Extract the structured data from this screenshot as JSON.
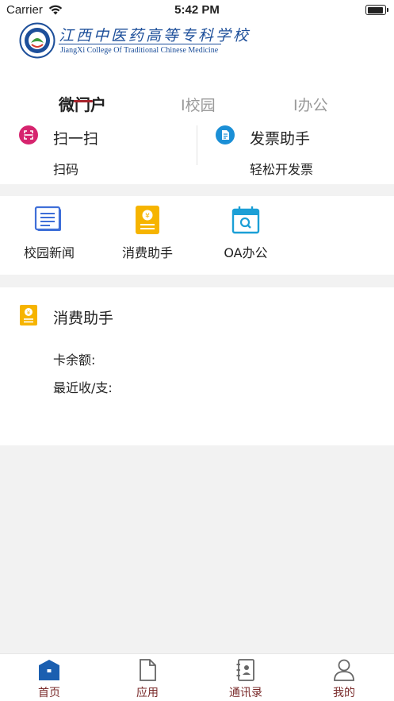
{
  "status_bar": {
    "carrier": "Carrier",
    "time": "5:42 PM",
    "battery_level": 0.95
  },
  "header": {
    "logo": {
      "name_cn": "江西中医药高等专科学校",
      "name_en": "JiangXi College Of Traditional Chinese Medicine"
    },
    "tabs": [
      {
        "label": "微门户",
        "active": true
      },
      {
        "label": "I校园",
        "active": false
      },
      {
        "label": "I办公",
        "active": false
      }
    ]
  },
  "quick_actions": [
    {
      "title": "扫一扫",
      "subtitle": "扫码",
      "icon": "scan-icon",
      "color": "#d6246e"
    },
    {
      "title": "发票助手",
      "subtitle": "轻松开发票",
      "icon": "invoice-icon",
      "color": "#1b8fd6"
    }
  ],
  "apps": [
    {
      "label": "校园新闻",
      "icon": "news-icon"
    },
    {
      "label": "消费助手",
      "icon": "wallet-icon"
    },
    {
      "label": "OA办公",
      "icon": "calendar-search-icon"
    }
  ],
  "card": {
    "title": "消费助手",
    "balance_label": "卡余额:",
    "recent_label": "最近收/支:"
  },
  "tabbar": [
    {
      "label": "首页",
      "icon": "home-icon",
      "active": true
    },
    {
      "label": "应用",
      "icon": "document-icon",
      "active": false
    },
    {
      "label": "通讯录",
      "icon": "contacts-icon",
      "active": false
    },
    {
      "label": "我的",
      "icon": "profile-icon",
      "active": false
    }
  ],
  "colors": {
    "accent": "#a8222b",
    "blue": "#1b5fb0",
    "yellow": "#f6b400",
    "pink": "#d6246e",
    "cyan": "#1b8fd6"
  }
}
